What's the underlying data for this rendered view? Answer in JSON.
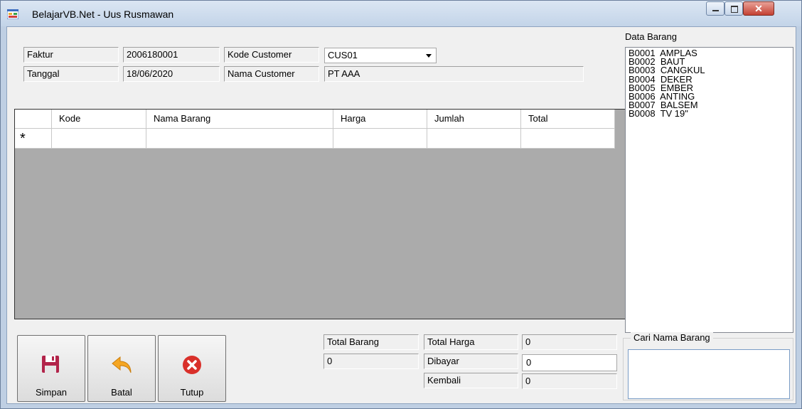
{
  "window": {
    "title": "BelajarVB.Net - Uus Rusmawan"
  },
  "header": {
    "faktur_label": "Faktur",
    "faktur_value": "2006180001",
    "tanggal_label": "Tanggal",
    "tanggal_value": "18/06/2020",
    "kode_customer_label": "Kode Customer",
    "kode_customer_value": "CUS01",
    "nama_customer_label": "Nama Customer",
    "nama_customer_value": "PT AAA"
  },
  "grid": {
    "columns": [
      "Kode",
      "Nama Barang",
      "Harga",
      "Jumlah",
      "Total"
    ],
    "new_row_marker": "*"
  },
  "buttons": {
    "simpan": "Simpan",
    "batal": "Batal",
    "tutup": "Tutup"
  },
  "totals": {
    "total_barang_label": "Total Barang",
    "total_barang_value": "0",
    "total_harga_label": "Total Harga",
    "total_harga_value": "0",
    "dibayar_label": "Dibayar",
    "dibayar_value": "0",
    "kembali_label": "Kembali",
    "kembali_value": "0"
  },
  "data_barang": {
    "title": "Data Barang",
    "items": [
      "B0001  AMPLAS",
      "B0002  BAUT",
      "B0003  CANGKUL",
      "B0004  DEKER",
      "B0005  EMBER",
      "B0006  ANTING",
      "B0007  BALSEM",
      "B0008  TV 19\""
    ]
  },
  "cari": {
    "title": "Cari Nama Barang",
    "value": ""
  },
  "icons": {
    "app": "form-icon",
    "simpan": "floppy-disk-icon",
    "batal": "undo-arrow-icon",
    "tutup": "close-circle-icon"
  },
  "colors": {
    "titlebar": "#c9d9ec",
    "grid_bg": "#ababab",
    "close_button": "#c44133",
    "tutup_icon": "#d9302a",
    "batal_icon": "#f5a623",
    "simpan_icon": "#b2244a"
  }
}
